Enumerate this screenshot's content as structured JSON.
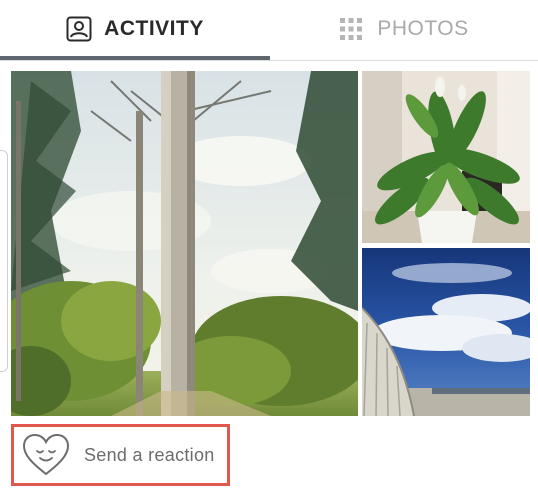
{
  "tabs": [
    {
      "label": "ACTIVITY",
      "icon": "person-icon",
      "selected": true
    },
    {
      "label": "PHOTOS",
      "icon": "grid-icon",
      "selected": false
    }
  ],
  "photos": [
    {
      "subject": "tall trees under a cloudy sky"
    },
    {
      "subject": "potted green plant"
    },
    {
      "subject": "blue sky with clouds over a curved wall"
    }
  ],
  "reaction": {
    "label": "Send a reaction",
    "icon": "smiling-heart-icon",
    "highlight_color": "#e2584e"
  },
  "colors": {
    "active_tab_text": "#2a2a2a",
    "inactive_tab_text": "#a9a9a9",
    "indicator": "#5f6670"
  }
}
